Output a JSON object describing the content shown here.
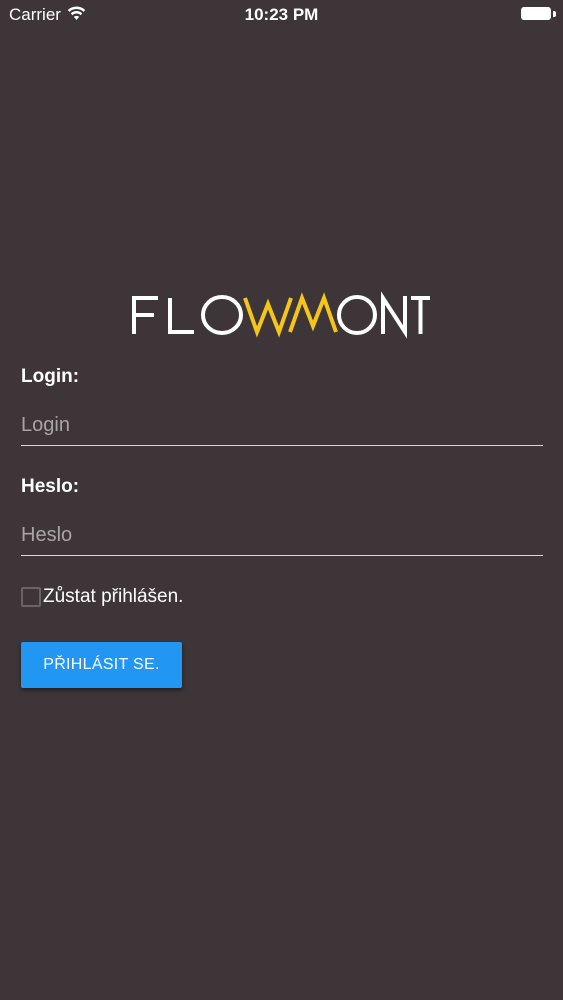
{
  "status_bar": {
    "carrier": "Carrier",
    "time": "10:23 PM",
    "wifi_icon": "wifi-icon",
    "battery_icon": "battery-full-icon"
  },
  "logo": {
    "text": "FLOWMONT",
    "white_part_left": "FLO",
    "yellow_part": "WM",
    "white_part_right": "ONT",
    "white_color": "#ffffff",
    "yellow_color": "#f5c518"
  },
  "form": {
    "login_label": "Login:",
    "login_placeholder": "Login",
    "login_value": "",
    "password_label": "Heslo:",
    "password_placeholder": "Heslo",
    "password_value": "",
    "remember_label": "Zůstat přihlášen.",
    "remember_checked": false,
    "submit_label": "PŘIHLÁSIT SE."
  },
  "colors": {
    "background": "#3d3538",
    "button": "#2196f3",
    "underline": "#d8d8d8"
  }
}
